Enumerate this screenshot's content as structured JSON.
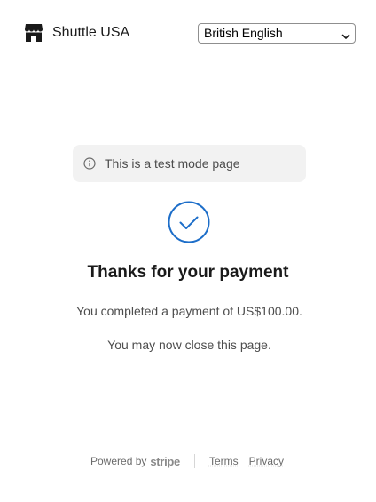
{
  "header": {
    "brand_name": "Shuttle USA",
    "brand_icon": "store-icon",
    "language_select": {
      "selected": "British English",
      "icon": "chevron-down-icon"
    }
  },
  "banner": {
    "text": "This is a test mode page",
    "icon": "info-icon"
  },
  "success": {
    "icon": "check-circle-icon",
    "accent_color": "#1d6ec9",
    "title": "Thanks for your payment",
    "message": "You completed a payment of US$100.00.",
    "close_note": "You may now close this page."
  },
  "footer": {
    "powered_by": "Powered by",
    "logo_text": "stripe",
    "terms_link": "Terms",
    "privacy_link": "Privacy"
  }
}
